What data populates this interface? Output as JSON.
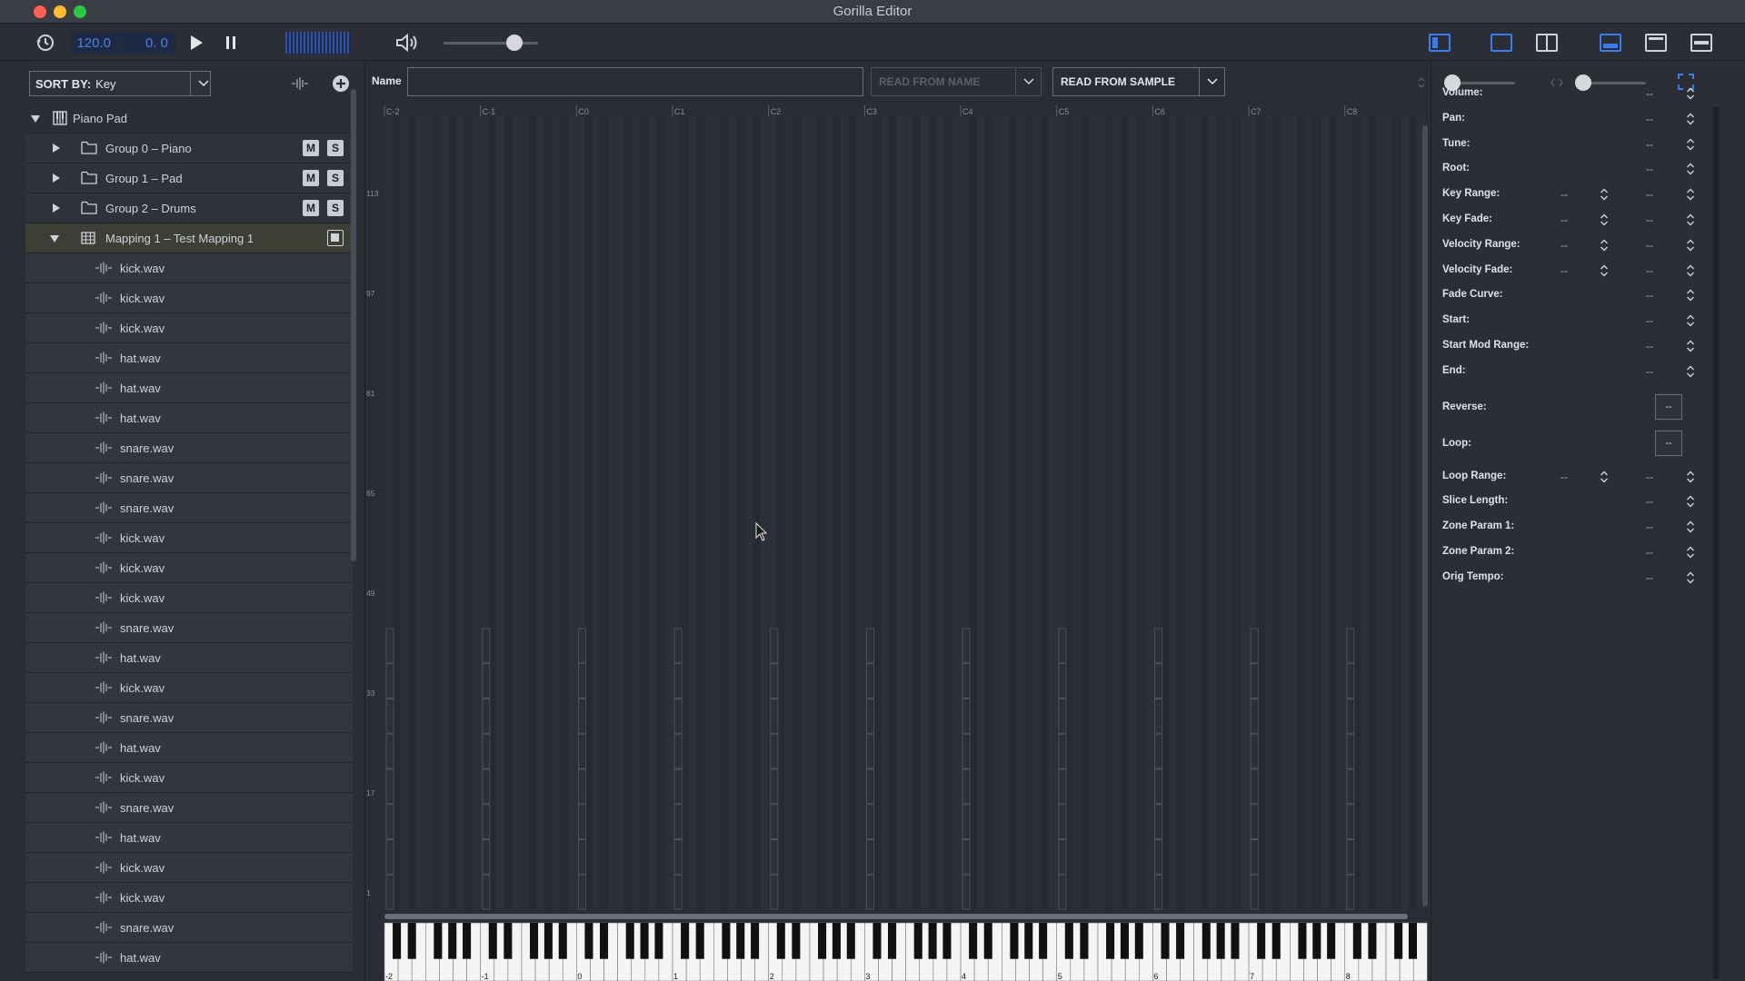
{
  "window": {
    "title": "Gorilla Editor"
  },
  "toolbar": {
    "tempo": "120.0",
    "position": "0. 0",
    "volume_level": 0.75
  },
  "left": {
    "sort_label": "SORT BY:",
    "sort_value": "Key",
    "tree": {
      "root": "Piano Pad",
      "groups": [
        "Group 0 – Piano",
        "Group 1 – Pad",
        "Group 2 – Drums"
      ],
      "mute_label": "M",
      "solo_label": "S",
      "mapping": "Mapping 1 – Test Mapping 1",
      "samples": [
        "kick.wav",
        "kick.wav",
        "kick.wav",
        "hat.wav",
        "hat.wav",
        "hat.wav",
        "snare.wav",
        "snare.wav",
        "snare.wav",
        "kick.wav",
        "kick.wav",
        "kick.wav",
        "snare.wav",
        "hat.wav",
        "kick.wav",
        "snare.wav",
        "hat.wav",
        "kick.wav",
        "snare.wav",
        "hat.wav",
        "kick.wav",
        "kick.wav",
        "snare.wav",
        "hat.wav"
      ]
    }
  },
  "center": {
    "name_label": "Name",
    "name_value": "",
    "read_from_name": "READ FROM NAME",
    "read_from_sample": "READ FROM SAMPLE",
    "octave_labels": [
      "C-2",
      "C-1",
      "C0",
      "C1",
      "C2",
      "C3",
      "C4",
      "C5",
      "C6",
      "C7",
      "C8"
    ],
    "velocity_labels": [
      "113",
      "97",
      "81",
      "65",
      "49",
      "33",
      "17",
      "1"
    ],
    "keyboard_labels": [
      "-2",
      "-1",
      "0",
      "1",
      "2",
      "3",
      "4",
      "5",
      "6",
      "7",
      "8"
    ]
  },
  "right": {
    "properties": [
      {
        "label": "Volume:",
        "v1": "",
        "v2": "--"
      },
      {
        "label": "Pan:",
        "v1": "",
        "v2": "--"
      },
      {
        "label": "Tune:",
        "v1": "",
        "v2": "--"
      },
      {
        "label": "Root:",
        "v1": "",
        "v2": "--"
      },
      {
        "label": "Key Range:",
        "v1": "--",
        "v2": "--"
      },
      {
        "label": "Key Fade:",
        "v1": "--",
        "v2": "--"
      },
      {
        "label": "Velocity Range:",
        "v1": "--",
        "v2": "--"
      },
      {
        "label": "Velocity Fade:",
        "v1": "--",
        "v2": "--"
      },
      {
        "label": "Fade Curve:",
        "v1": "",
        "v2": "--"
      },
      {
        "label": "Start:",
        "v1": "",
        "v2": "--"
      },
      {
        "label": "Start Mod Range:",
        "v1": "",
        "v2": "--"
      },
      {
        "label": "End:",
        "v1": "",
        "v2": "--"
      }
    ],
    "reverse_label": "Reverse:",
    "reverse_value": "--",
    "loop_label": "Loop:",
    "loop_value": "--",
    "properties2": [
      {
        "label": "Loop Range:",
        "v1": "--",
        "v2": "--"
      },
      {
        "label": "Slice Length:",
        "v1": "",
        "v2": "--"
      },
      {
        "label": "Zone Param 1:",
        "v1": "",
        "v2": "--"
      },
      {
        "label": "Zone Param 2:",
        "v1": "",
        "v2": "--"
      },
      {
        "label": "Orig Tempo:",
        "v1": "",
        "v2": "--"
      }
    ]
  }
}
